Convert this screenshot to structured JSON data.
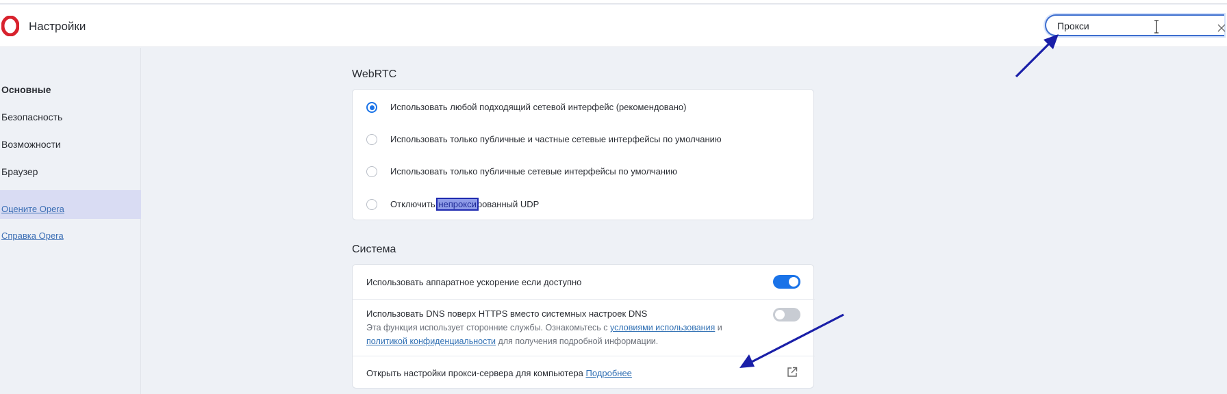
{
  "header": {
    "title": "Настройки",
    "search_value": "Прокси",
    "search_display": "Прокси"
  },
  "sidebar": {
    "items": [
      {
        "label": "Основные",
        "active": true
      },
      {
        "label": "Безопасность",
        "active": false
      },
      {
        "label": "Возможности",
        "active": false
      },
      {
        "label": "Браузер",
        "active": false
      }
    ],
    "links": [
      {
        "label": "Оцените Opera"
      },
      {
        "label": "Справка Opera"
      }
    ]
  },
  "webrtc": {
    "title": "WebRTC",
    "options": [
      {
        "label": "Использовать любой подходящий сетевой интерфейс (рекомендовано)",
        "checked": true
      },
      {
        "label": "Использовать только публичные и частные сетевые интерфейсы по умолчанию",
        "checked": false
      },
      {
        "label": "Использовать только публичные сетевые интерфейсы по умолчанию",
        "checked": false
      },
      {
        "label_before": "Отключить ",
        "label_highlight": "непрокси",
        "label_after": "рованный UDP",
        "checked": false
      }
    ]
  },
  "system": {
    "title": "Система",
    "hardware_accel": {
      "label": "Использовать аппаратное ускорение если доступно",
      "enabled": true
    },
    "dns": {
      "label": "Использовать DNS поверх HTTPS вместо системных настроек DNS",
      "enabled": false,
      "desc_line1_before": "Эта функция использует сторонние службы. Ознакомьтесь с ",
      "desc_link1": "условиями использования",
      "desc_line1_after": " и",
      "desc_link2": "политикой конфиденциальности",
      "desc_line2_after": " для получения подробной информации."
    },
    "proxy": {
      "label": "Открыть настройки прокси-сервера для компьютера",
      "link": "Подробнее"
    }
  },
  "colors": {
    "accent": "#1a73e8",
    "annotation_arrow": "#1a1fa8",
    "highlight": "#8f9ce8",
    "logo": "#d8222d"
  },
  "icons": {
    "logo": "opera-logo",
    "clear": "close-icon",
    "caret": "text-cursor-icon",
    "external": "external-link-icon"
  }
}
